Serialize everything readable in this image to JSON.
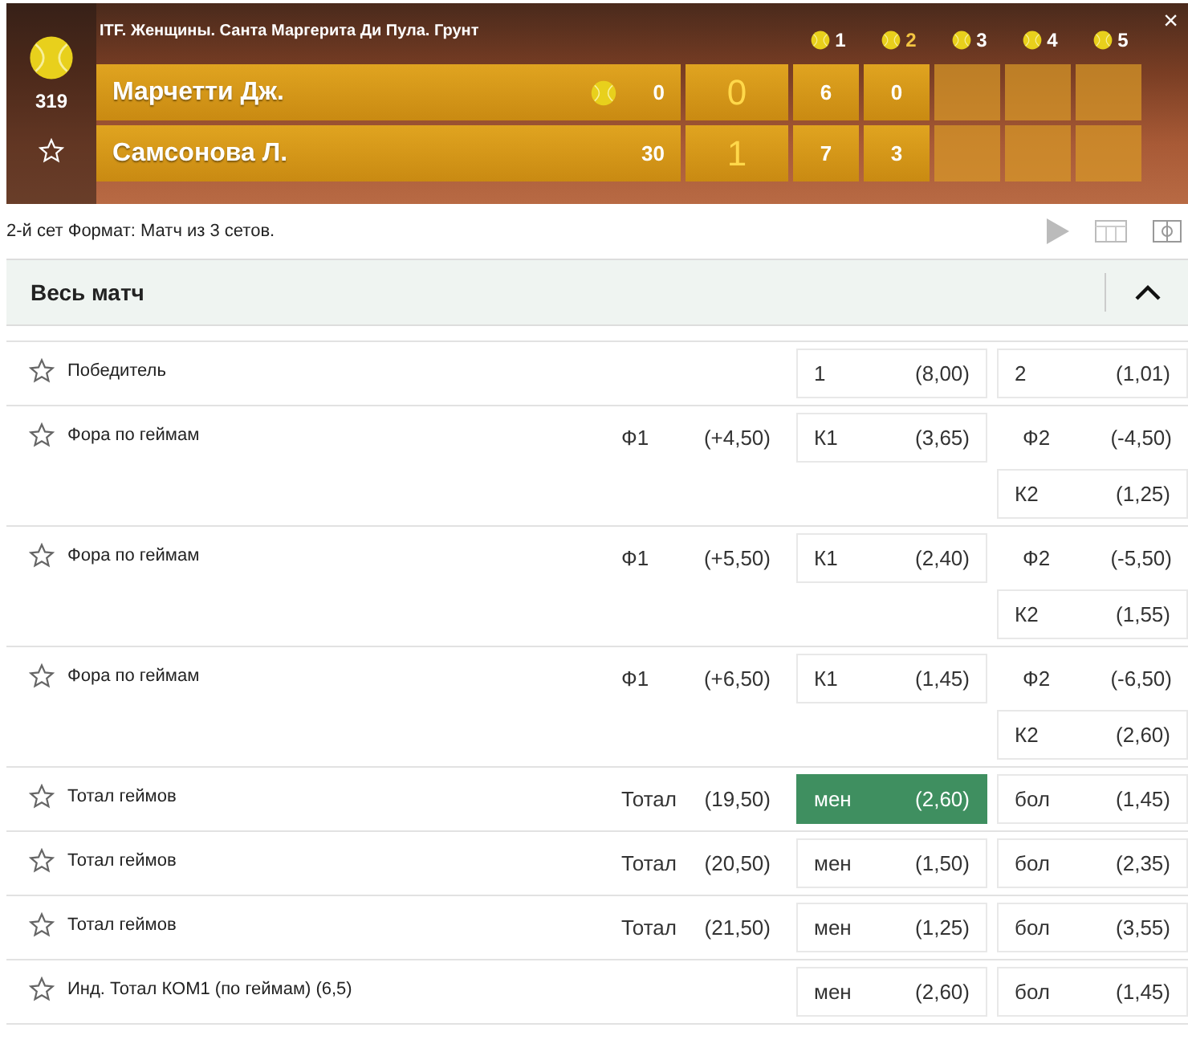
{
  "scoreboard": {
    "title": "ITF. Женщины. Санта Маргерита Ди Пула. Грунт",
    "counter": "319",
    "favorite": false,
    "sets": [
      {
        "label": "1",
        "selected": false
      },
      {
        "label": "2",
        "selected": true
      },
      {
        "label": "3",
        "selected": false
      },
      {
        "label": "4",
        "selected": false
      },
      {
        "label": "5",
        "selected": false
      }
    ],
    "players": [
      {
        "name": "Марчетти Дж.",
        "serving": true,
        "points": "0",
        "games": "0",
        "set_scores": [
          "6",
          "0"
        ]
      },
      {
        "name": "Самсонова Л.",
        "serving": false,
        "points": "30",
        "games": "1",
        "set_scores": [
          "7",
          "3"
        ]
      }
    ],
    "close": "×"
  },
  "info": "2-й сет Формат: Матч из 3 сетов.",
  "section": {
    "title": "Весь матч",
    "expanded": true
  },
  "markets": [
    {
      "name": "Победитель",
      "favorite": false,
      "lines": [
        [
          {
            "kind": "odds",
            "label": "1",
            "value": "(8,00)",
            "selected": false
          },
          {
            "kind": "odds",
            "label": "2",
            "value": "(1,01)",
            "selected": false
          }
        ]
      ]
    },
    {
      "name": "Фора по геймам",
      "favorite": false,
      "lines": [
        [
          {
            "kind": "plain",
            "label": "Ф1",
            "value": "(+4,50)"
          },
          {
            "kind": "odds",
            "label": "К1",
            "value": "(3,65)",
            "selected": false
          },
          {
            "kind": "plain",
            "label": "Ф2",
            "value": "(-4,50)"
          }
        ],
        [
          {
            "kind": "odds",
            "label": "К2",
            "value": "(1,25)",
            "selected": false
          }
        ]
      ]
    },
    {
      "name": "Фора по геймам",
      "favorite": false,
      "lines": [
        [
          {
            "kind": "plain",
            "label": "Ф1",
            "value": "(+5,50)"
          },
          {
            "kind": "odds",
            "label": "К1",
            "value": "(2,40)",
            "selected": false
          },
          {
            "kind": "plain",
            "label": "Ф2",
            "value": "(-5,50)"
          }
        ],
        [
          {
            "kind": "odds",
            "label": "К2",
            "value": "(1,55)",
            "selected": false
          }
        ]
      ]
    },
    {
      "name": "Фора по геймам",
      "favorite": false,
      "lines": [
        [
          {
            "kind": "plain",
            "label": "Ф1",
            "value": "(+6,50)"
          },
          {
            "kind": "odds",
            "label": "К1",
            "value": "(1,45)",
            "selected": false
          },
          {
            "kind": "plain",
            "label": "Ф2",
            "value": "(-6,50)"
          }
        ],
        [
          {
            "kind": "odds",
            "label": "К2",
            "value": "(2,60)",
            "selected": false
          }
        ]
      ]
    },
    {
      "name": "Тотал геймов",
      "favorite": false,
      "lines": [
        [
          {
            "kind": "plain",
            "label": "Тотал",
            "value": "(19,50)"
          },
          {
            "kind": "odds",
            "label": "мен",
            "value": "(2,60)",
            "selected": true
          },
          {
            "kind": "odds",
            "label": "бол",
            "value": "(1,45)",
            "selected": false
          }
        ]
      ]
    },
    {
      "name": "Тотал геймов",
      "favorite": false,
      "lines": [
        [
          {
            "kind": "plain",
            "label": "Тотал",
            "value": "(20,50)"
          },
          {
            "kind": "odds",
            "label": "мен",
            "value": "(1,50)",
            "selected": false
          },
          {
            "kind": "odds",
            "label": "бол",
            "value": "(2,35)",
            "selected": false
          }
        ]
      ]
    },
    {
      "name": "Тотал геймов",
      "favorite": false,
      "lines": [
        [
          {
            "kind": "plain",
            "label": "Тотал",
            "value": "(21,50)"
          },
          {
            "kind": "odds",
            "label": "мен",
            "value": "(1,25)",
            "selected": false
          },
          {
            "kind": "odds",
            "label": "бол",
            "value": "(3,55)",
            "selected": false
          }
        ]
      ]
    },
    {
      "name": "Инд. Тотал КОМ1 (по геймам) (6,5)",
      "favorite": false,
      "lines": [
        [
          {
            "kind": "odds",
            "label": "мен",
            "value": "(2,60)",
            "selected": false
          },
          {
            "kind": "odds",
            "label": "бол",
            "value": "(1,45)",
            "selected": false
          }
        ]
      ]
    }
  ]
}
